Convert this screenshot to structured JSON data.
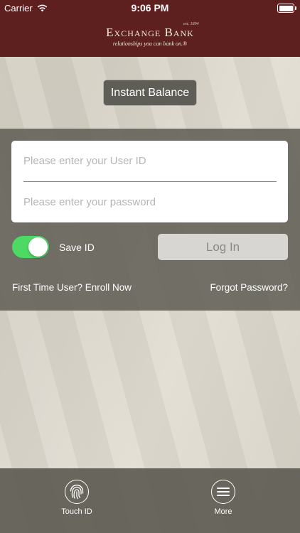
{
  "status_bar": {
    "carrier": "Carrier",
    "time": "9:06 PM",
    "wifi_icon": "wifi-icon",
    "battery_icon": "battery-icon"
  },
  "header": {
    "logo_name": "Exchange Bank",
    "logo_est": "est. 1894",
    "logo_tagline": "relationships you can bank on.®",
    "background_color": "#5e1f1f"
  },
  "instant_balance": {
    "label": "Instant Balance"
  },
  "login": {
    "user_id_placeholder": "Please enter your User ID",
    "user_id_value": "",
    "password_placeholder": "Please enter your password",
    "password_value": "",
    "save_id_label": "Save ID",
    "save_id_enabled": true,
    "toggle_color": "#4cd964",
    "login_label": "Log In",
    "enroll_label": "First Time User? Enroll Now",
    "forgot_label": "Forgot Password?"
  },
  "bottom_bar": {
    "touch_id_label": "Touch ID",
    "touch_id_icon": "fingerprint-icon",
    "more_label": "More",
    "more_icon": "menu-icon"
  }
}
